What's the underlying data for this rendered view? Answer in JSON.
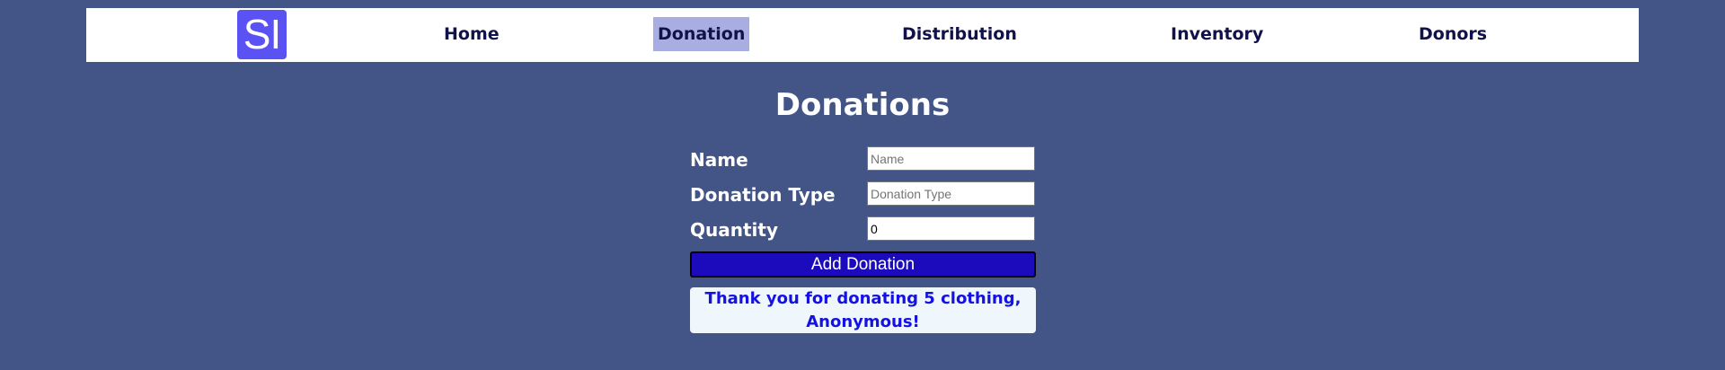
{
  "nav": {
    "logo_text": "SI",
    "items": [
      {
        "label": "Home"
      },
      {
        "label": "Donation"
      },
      {
        "label": "Distribution"
      },
      {
        "label": "Inventory"
      },
      {
        "label": "Donors"
      }
    ],
    "active_item": "Donation",
    "active_color": "#a9aee2"
  },
  "page": {
    "title": "Donations"
  },
  "form": {
    "name_label": "Name",
    "name_placeholder": "Name",
    "name_value": "",
    "type_label": "Donation Type",
    "type_placeholder": "Donation Type",
    "type_value": "",
    "quantity_label": "Quantity",
    "quantity_value": "0",
    "submit_label": "Add Donation",
    "submit_color": "#1b0bbd"
  },
  "message": {
    "text": "Thank you for donating 5 clothing, Anonymous!",
    "color": "#1411e3"
  },
  "theme": {
    "background": "#435587",
    "logo_color": "#5a52f3"
  }
}
